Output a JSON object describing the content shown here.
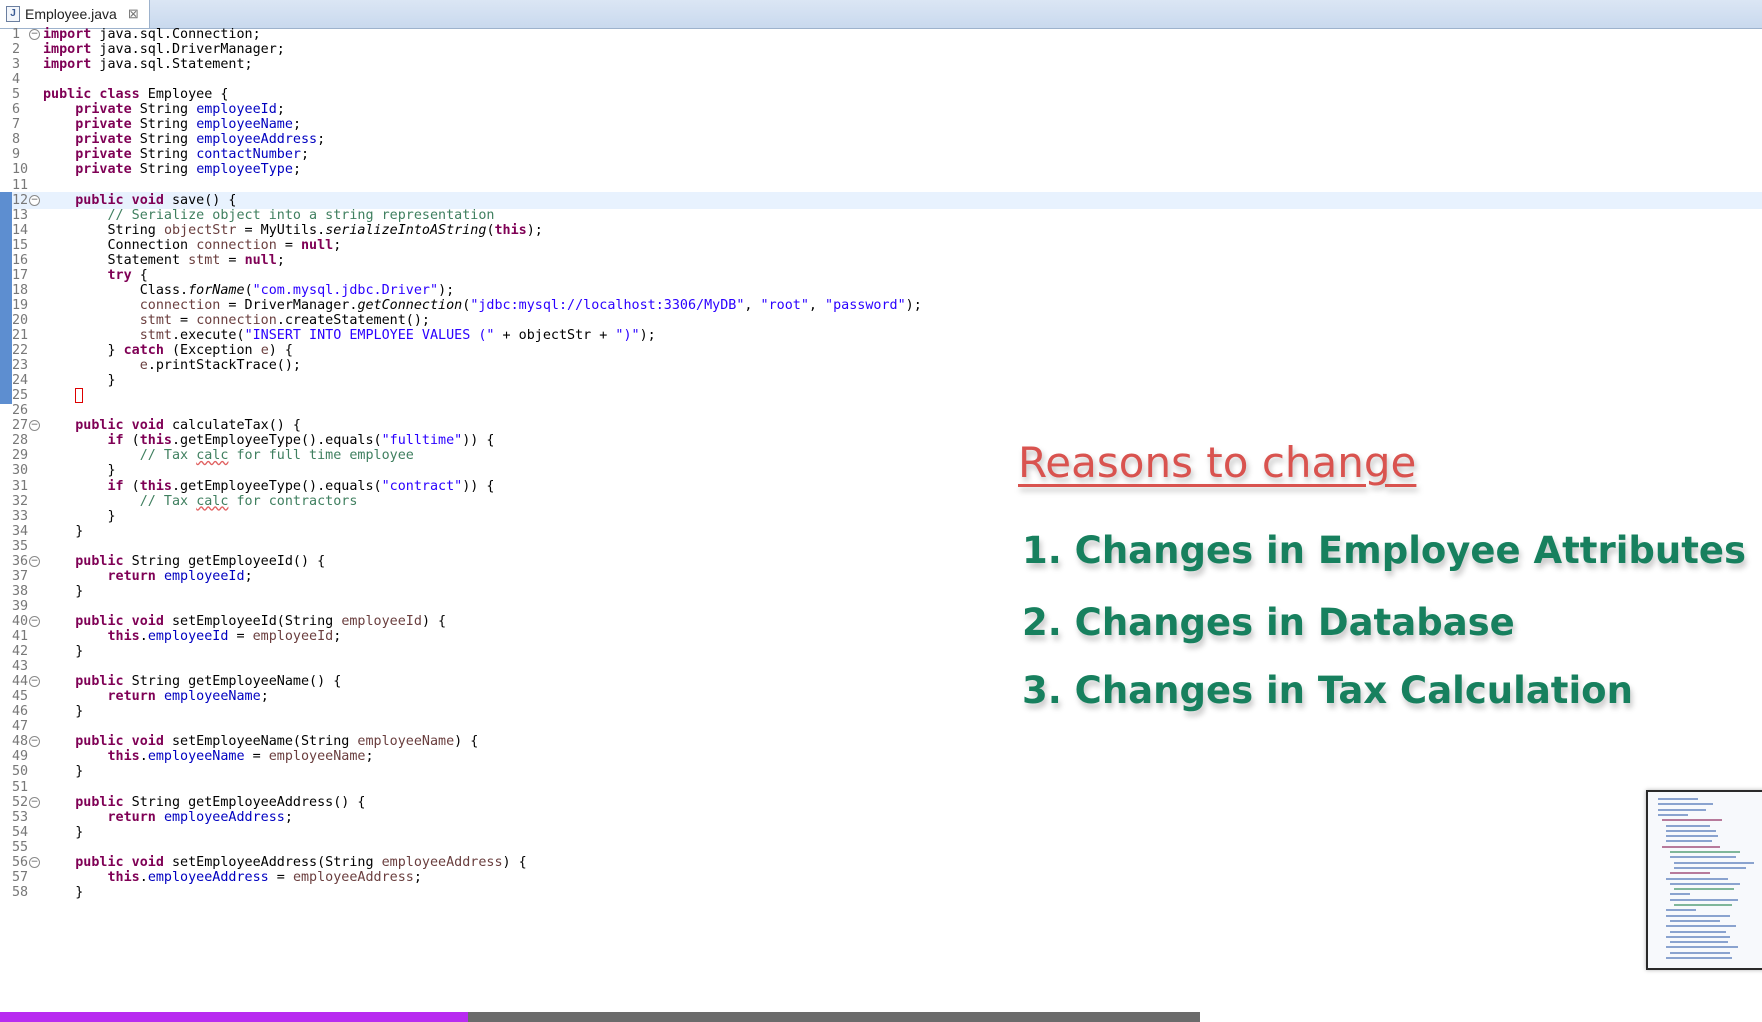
{
  "tab": {
    "label": "Employee.java",
    "close": "⊠"
  },
  "overlay": {
    "title": "Reasons to change",
    "reasons": [
      "1. Changes in Employee Attributes",
      "2. Changes in Database",
      "3. Changes in Tax Calculation"
    ]
  },
  "editor": {
    "current_line": 12,
    "changed_lines": [
      12,
      25
    ],
    "lines": [
      {
        "n": 1,
        "fold": true,
        "tokens": [
          {
            "t": "import",
            "c": "kw"
          },
          {
            "t": " java.sql.Connection;"
          }
        ]
      },
      {
        "n": 2,
        "tokens": [
          {
            "t": "import",
            "c": "kw"
          },
          {
            "t": " java.sql.DriverManager;"
          }
        ]
      },
      {
        "n": 3,
        "tokens": [
          {
            "t": "import",
            "c": "kw"
          },
          {
            "t": " java.sql.Statement;"
          }
        ]
      },
      {
        "n": 4,
        "tokens": []
      },
      {
        "n": 5,
        "tokens": [
          {
            "t": "public class",
            "c": "kw"
          },
          {
            "t": " Employee {"
          }
        ]
      },
      {
        "n": 6,
        "tokens": [
          {
            "t": "    "
          },
          {
            "t": "private",
            "c": "kw"
          },
          {
            "t": " String "
          },
          {
            "t": "employeeId",
            "c": "fld"
          },
          {
            "t": ";"
          }
        ]
      },
      {
        "n": 7,
        "tokens": [
          {
            "t": "    "
          },
          {
            "t": "private",
            "c": "kw"
          },
          {
            "t": " String "
          },
          {
            "t": "employeeName",
            "c": "fld"
          },
          {
            "t": ";"
          }
        ]
      },
      {
        "n": 8,
        "tokens": [
          {
            "t": "    "
          },
          {
            "t": "private",
            "c": "kw"
          },
          {
            "t": " String "
          },
          {
            "t": "employeeAddress",
            "c": "fld"
          },
          {
            "t": ";"
          }
        ]
      },
      {
        "n": 9,
        "tokens": [
          {
            "t": "    "
          },
          {
            "t": "private",
            "c": "kw"
          },
          {
            "t": " String "
          },
          {
            "t": "contactNumber",
            "c": "fld"
          },
          {
            "t": ";"
          }
        ]
      },
      {
        "n": 10,
        "tokens": [
          {
            "t": "    "
          },
          {
            "t": "private",
            "c": "kw"
          },
          {
            "t": " String "
          },
          {
            "t": "employeeType",
            "c": "fld"
          },
          {
            "t": ";"
          }
        ]
      },
      {
        "n": 11,
        "tokens": []
      },
      {
        "n": 12,
        "fold": true,
        "tokens": [
          {
            "t": "    "
          },
          {
            "t": "public void",
            "c": "kw"
          },
          {
            "t": " save() {"
          }
        ]
      },
      {
        "n": 13,
        "tokens": [
          {
            "t": "        "
          },
          {
            "t": "// Serialize object into a string representation",
            "c": "cm"
          }
        ]
      },
      {
        "n": 14,
        "tokens": [
          {
            "t": "        String "
          },
          {
            "t": "objectStr",
            "c": "var"
          },
          {
            "t": " = MyUtils."
          },
          {
            "t": "serializeIntoAString",
            "c": "it"
          },
          {
            "t": "("
          },
          {
            "t": "this",
            "c": "kw"
          },
          {
            "t": ");"
          }
        ]
      },
      {
        "n": 15,
        "tokens": [
          {
            "t": "        Connection "
          },
          {
            "t": "connection",
            "c": "var"
          },
          {
            "t": " = "
          },
          {
            "t": "null",
            "c": "kw"
          },
          {
            "t": ";"
          }
        ]
      },
      {
        "n": 16,
        "tokens": [
          {
            "t": "        Statement "
          },
          {
            "t": "stmt",
            "c": "var"
          },
          {
            "t": " = "
          },
          {
            "t": "null",
            "c": "kw"
          },
          {
            "t": ";"
          }
        ]
      },
      {
        "n": 17,
        "tokens": [
          {
            "t": "        "
          },
          {
            "t": "try",
            "c": "kw"
          },
          {
            "t": " {"
          }
        ]
      },
      {
        "n": 18,
        "tokens": [
          {
            "t": "            Class."
          },
          {
            "t": "forName",
            "c": "it"
          },
          {
            "t": "("
          },
          {
            "t": "\"com.mysql.jdbc.Driver\"",
            "c": "str"
          },
          {
            "t": ");"
          }
        ]
      },
      {
        "n": 19,
        "tokens": [
          {
            "t": "            "
          },
          {
            "t": "connection",
            "c": "var"
          },
          {
            "t": " = DriverManager."
          },
          {
            "t": "getConnection",
            "c": "it"
          },
          {
            "t": "("
          },
          {
            "t": "\"jdbc:mysql://localhost:3306/MyDB\"",
            "c": "str"
          },
          {
            "t": ", "
          },
          {
            "t": "\"root\"",
            "c": "str"
          },
          {
            "t": ", "
          },
          {
            "t": "\"password\"",
            "c": "str"
          },
          {
            "t": ");"
          }
        ]
      },
      {
        "n": 20,
        "tokens": [
          {
            "t": "            "
          },
          {
            "t": "stmt",
            "c": "var"
          },
          {
            "t": " = "
          },
          {
            "t": "connection",
            "c": "var"
          },
          {
            "t": ".createStatement();"
          }
        ]
      },
      {
        "n": 21,
        "tokens": [
          {
            "t": "            "
          },
          {
            "t": "stmt",
            "c": "var"
          },
          {
            "t": ".execute("
          },
          {
            "t": "\"INSERT INTO EMPLOYEE VALUES (\"",
            "c": "str"
          },
          {
            "t": " + objectStr + "
          },
          {
            "t": "\")\"",
            "c": "str"
          },
          {
            "t": ");"
          }
        ]
      },
      {
        "n": 22,
        "tokens": [
          {
            "t": "        } "
          },
          {
            "t": "catch",
            "c": "kw"
          },
          {
            "t": " (Exception "
          },
          {
            "t": "e",
            "c": "var"
          },
          {
            "t": ") {"
          }
        ]
      },
      {
        "n": 23,
        "tokens": [
          {
            "t": "            "
          },
          {
            "t": "e",
            "c": "var"
          },
          {
            "t": ".printStackTrace();"
          }
        ]
      },
      {
        "n": 24,
        "tokens": [
          {
            "t": "        }"
          }
        ]
      },
      {
        "n": 25,
        "tokens": [
          {
            "t": "    "
          },
          {
            "t": "}",
            "c": "cursor"
          }
        ]
      },
      {
        "n": 26,
        "tokens": []
      },
      {
        "n": 27,
        "fold": true,
        "tokens": [
          {
            "t": "    "
          },
          {
            "t": "public void",
            "c": "kw"
          },
          {
            "t": " calculateTax() {"
          }
        ]
      },
      {
        "n": 28,
        "tokens": [
          {
            "t": "        "
          },
          {
            "t": "if",
            "c": "kw"
          },
          {
            "t": " ("
          },
          {
            "t": "this",
            "c": "kw"
          },
          {
            "t": ".getEmployeeType().equals("
          },
          {
            "t": "\"fulltime\"",
            "c": "str"
          },
          {
            "t": ")) {"
          }
        ]
      },
      {
        "n": 29,
        "tokens": [
          {
            "t": "            "
          },
          {
            "t": "// Tax ",
            "c": "cm"
          },
          {
            "t": "calc",
            "c": "cm sq"
          },
          {
            "t": " for full time employee",
            "c": "cm"
          }
        ]
      },
      {
        "n": 30,
        "tokens": [
          {
            "t": "        }"
          }
        ]
      },
      {
        "n": 31,
        "tokens": [
          {
            "t": "        "
          },
          {
            "t": "if",
            "c": "kw"
          },
          {
            "t": " ("
          },
          {
            "t": "this",
            "c": "kw"
          },
          {
            "t": ".getEmployeeType().equals("
          },
          {
            "t": "\"contract\"",
            "c": "str"
          },
          {
            "t": ")) {"
          }
        ]
      },
      {
        "n": 32,
        "tokens": [
          {
            "t": "            "
          },
          {
            "t": "// Tax ",
            "c": "cm"
          },
          {
            "t": "calc",
            "c": "cm sq"
          },
          {
            "t": " for contractors",
            "c": "cm"
          }
        ]
      },
      {
        "n": 33,
        "tokens": [
          {
            "t": "        }"
          }
        ]
      },
      {
        "n": 34,
        "tokens": [
          {
            "t": "    }"
          }
        ]
      },
      {
        "n": 35,
        "tokens": []
      },
      {
        "n": 36,
        "fold": true,
        "tokens": [
          {
            "t": "    "
          },
          {
            "t": "public",
            "c": "kw"
          },
          {
            "t": " String getEmployeeId() {"
          }
        ]
      },
      {
        "n": 37,
        "tokens": [
          {
            "t": "        "
          },
          {
            "t": "return",
            "c": "kw"
          },
          {
            "t": " "
          },
          {
            "t": "employeeId",
            "c": "fld"
          },
          {
            "t": ";"
          }
        ]
      },
      {
        "n": 38,
        "tokens": [
          {
            "t": "    }"
          }
        ]
      },
      {
        "n": 39,
        "tokens": []
      },
      {
        "n": 40,
        "fold": true,
        "tokens": [
          {
            "t": "    "
          },
          {
            "t": "public void",
            "c": "kw"
          },
          {
            "t": " setEmployeeId(String "
          },
          {
            "t": "employeeId",
            "c": "var"
          },
          {
            "t": ") {"
          }
        ]
      },
      {
        "n": 41,
        "tokens": [
          {
            "t": "        "
          },
          {
            "t": "this",
            "c": "kw"
          },
          {
            "t": "."
          },
          {
            "t": "employeeId",
            "c": "fld"
          },
          {
            "t": " = "
          },
          {
            "t": "employeeId",
            "c": "var"
          },
          {
            "t": ";"
          }
        ]
      },
      {
        "n": 42,
        "tokens": [
          {
            "t": "    }"
          }
        ]
      },
      {
        "n": 43,
        "tokens": []
      },
      {
        "n": 44,
        "fold": true,
        "tokens": [
          {
            "t": "    "
          },
          {
            "t": "public",
            "c": "kw"
          },
          {
            "t": " String getEmployeeName() {"
          }
        ]
      },
      {
        "n": 45,
        "tokens": [
          {
            "t": "        "
          },
          {
            "t": "return",
            "c": "kw"
          },
          {
            "t": " "
          },
          {
            "t": "employeeName",
            "c": "fld"
          },
          {
            "t": ";"
          }
        ]
      },
      {
        "n": 46,
        "tokens": [
          {
            "t": "    }"
          }
        ]
      },
      {
        "n": 47,
        "tokens": []
      },
      {
        "n": 48,
        "fold": true,
        "tokens": [
          {
            "t": "    "
          },
          {
            "t": "public void",
            "c": "kw"
          },
          {
            "t": " setEmployeeName(String "
          },
          {
            "t": "employeeName",
            "c": "var"
          },
          {
            "t": ") {"
          }
        ]
      },
      {
        "n": 49,
        "tokens": [
          {
            "t": "        "
          },
          {
            "t": "this",
            "c": "kw"
          },
          {
            "t": "."
          },
          {
            "t": "employeeName",
            "c": "fld"
          },
          {
            "t": " = "
          },
          {
            "t": "employeeName",
            "c": "var"
          },
          {
            "t": ";"
          }
        ]
      },
      {
        "n": 50,
        "tokens": [
          {
            "t": "    }"
          }
        ]
      },
      {
        "n": 51,
        "tokens": []
      },
      {
        "n": 52,
        "fold": true,
        "tokens": [
          {
            "t": "    "
          },
          {
            "t": "public",
            "c": "kw"
          },
          {
            "t": " String getEmployeeAddress() {"
          }
        ]
      },
      {
        "n": 53,
        "tokens": [
          {
            "t": "        "
          },
          {
            "t": "return",
            "c": "kw"
          },
          {
            "t": " "
          },
          {
            "t": "employeeAddress",
            "c": "fld"
          },
          {
            "t": ";"
          }
        ]
      },
      {
        "n": 54,
        "tokens": [
          {
            "t": "    }"
          }
        ]
      },
      {
        "n": 55,
        "tokens": []
      },
      {
        "n": 56,
        "fold": true,
        "tokens": [
          {
            "t": "    "
          },
          {
            "t": "public void",
            "c": "kw"
          },
          {
            "t": " setEmployeeAddress(String "
          },
          {
            "t": "employeeAddress",
            "c": "var"
          },
          {
            "t": ") {"
          }
        ]
      },
      {
        "n": 57,
        "tokens": [
          {
            "t": "        "
          },
          {
            "t": "this",
            "c": "kw"
          },
          {
            "t": "."
          },
          {
            "t": "employeeAddress",
            "c": "fld"
          },
          {
            "t": " = "
          },
          {
            "t": "employeeAddress",
            "c": "var"
          },
          {
            "t": ";"
          }
        ]
      },
      {
        "n": 58,
        "tokens": [
          {
            "t": "    }"
          }
        ]
      }
    ]
  },
  "video_progress": 0.39,
  "colors": {
    "title_red": "#d9534f",
    "reason_green": "#17805e",
    "progress": "#b82bf0",
    "keyword": "#7f0055",
    "field": "#0000c0",
    "string": "#2a00ff",
    "comment": "#3f7f5f"
  }
}
